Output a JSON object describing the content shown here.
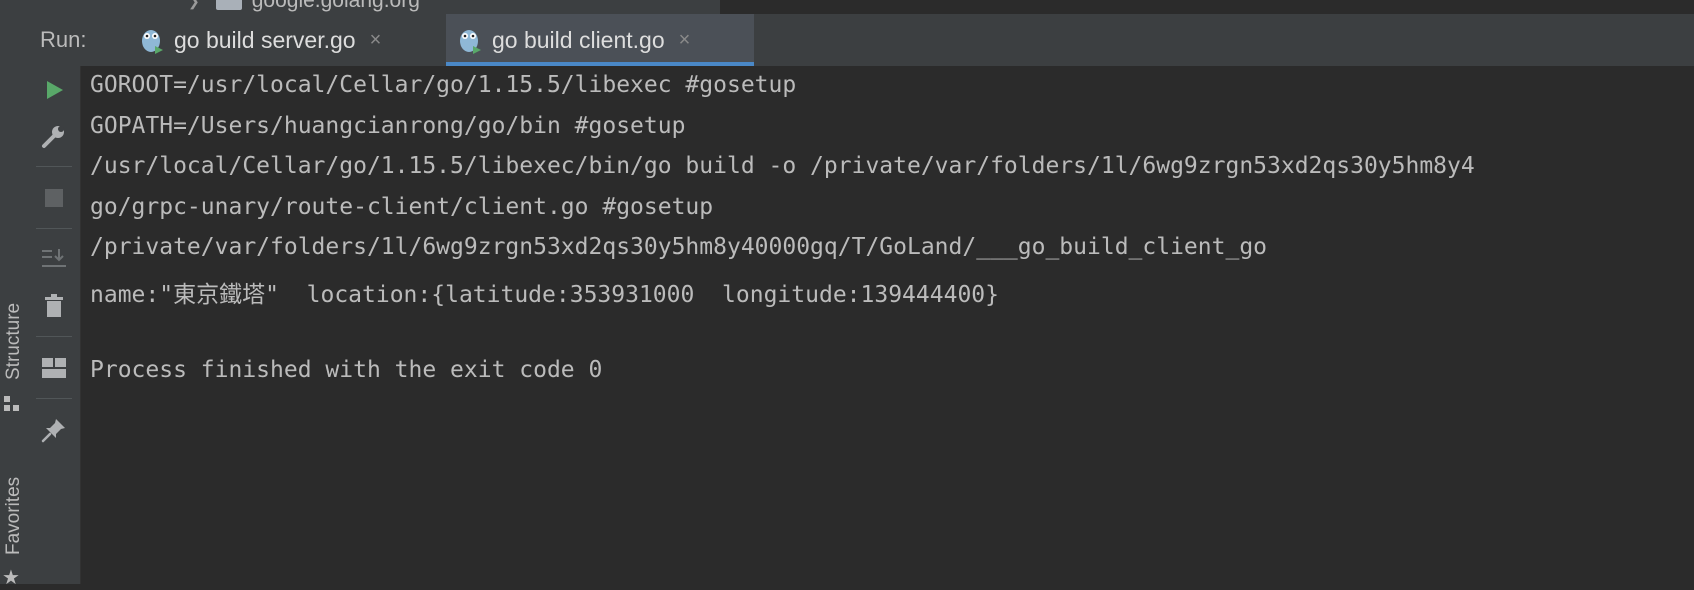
{
  "project_tree": {
    "folder_label": "google.golang.org"
  },
  "run_panel": {
    "label": "Run:",
    "tabs": [
      {
        "label": "go build server.go",
        "close": "×",
        "active": false
      },
      {
        "label": "go build client.go",
        "close": "×",
        "active": true
      }
    ]
  },
  "side_tabs": {
    "structure": "Structure",
    "favorites": "Favorites"
  },
  "console": {
    "lines": [
      "GOROOT=/usr/local/Cellar/go/1.15.5/libexec #gosetup",
      "GOPATH=/Users/huangcianrong/go/bin #gosetup",
      "/usr/local/Cellar/go/1.15.5/libexec/bin/go build -o /private/var/folders/1l/6wg9zrgn53xd2qs30y5hm8y4",
      "go/grpc-unary/route-client/client.go #gosetup",
      "/private/var/folders/1l/6wg9zrgn53xd2qs30y5hm8y40000gq/T/GoLand/___go_build_client_go",
      "name:\"東京鐵塔\"  location:{latitude:353931000  longitude:139444400}",
      "",
      "Process finished with the exit code 0"
    ]
  },
  "colors": {
    "panel_bg": "#3c3f41",
    "console_bg": "#2b2b2b",
    "text": "#bbbbbb",
    "run_green": "#59a869",
    "active_tab_accent": "#4a88c7"
  },
  "icons": {
    "tab_icon": "gopher-icon",
    "tools": [
      "rerun-icon",
      "wrench-icon",
      "stop-icon",
      "scroll-to-end-icon",
      "trash-icon",
      "layout-icon",
      "pin-icon"
    ]
  }
}
